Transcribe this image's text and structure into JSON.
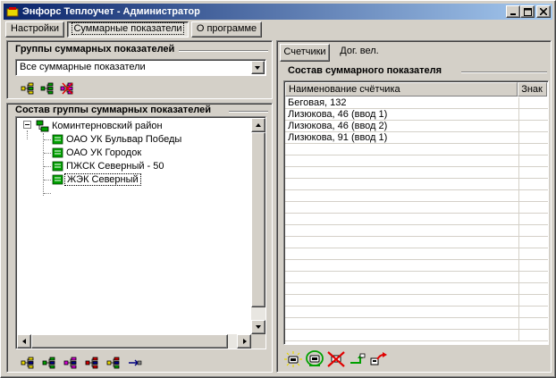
{
  "window": {
    "title": "Энфорс Теплоучет - Администратор",
    "buttons": {
      "minimize": "_",
      "maximize": "□",
      "close": "×"
    }
  },
  "menu": {
    "settings": "Настройки",
    "summary": "Суммарные показатели",
    "about": "О программе"
  },
  "left": {
    "groups_title": "Группы суммарных показателей",
    "groups_combo_value": "Все суммарные показатели",
    "composition_title": "Состав группы суммарных показателей",
    "tree": {
      "root": "Коминтерновский район",
      "children": [
        "ОАО УК Бульвар Победы",
        "ОАО УК Городок",
        "ПЖСК Северный - 50",
        "ЖЭК Северный"
      ],
      "selected_index": 3
    }
  },
  "right": {
    "tabs": [
      "Счетчики",
      "Дог. вел."
    ],
    "active_tab": 0,
    "composition_title": "Состав суммарного показателя",
    "columns": [
      "Наименование счётчика",
      "Знак"
    ],
    "rows": [
      [
        "Беговая, 132",
        ""
      ],
      [
        "Лизюкова, 46 (ввод 1)",
        ""
      ],
      [
        "Лизюкова, 46 (ввод 2)",
        ""
      ],
      [
        "Лизюкова, 91 (ввод 1)",
        ""
      ]
    ]
  },
  "colors": {
    "titlebar_start": "#0a246a",
    "titlebar_end": "#a6caf0",
    "face": "#d4d0c8",
    "icon_green": "#00a000",
    "icon_yellow": "#e8d800",
    "icon_magenta": "#d000d0",
    "icon_red": "#e00000"
  },
  "icons": {
    "groups_toolbar": [
      "add-group-icon",
      "edit-group-icon",
      "delete-group-icon"
    ],
    "tree_toolbar": [
      "add-node-icon",
      "add-subnode-icon",
      "delete-node-icon",
      "move-up-icon",
      "move-down-icon",
      "transfer-icon"
    ],
    "meter_toolbar": [
      "add-meter-icon",
      "edit-meter-icon",
      "delete-meter-icon",
      "sign-toggle-icon",
      "export-icon"
    ]
  }
}
